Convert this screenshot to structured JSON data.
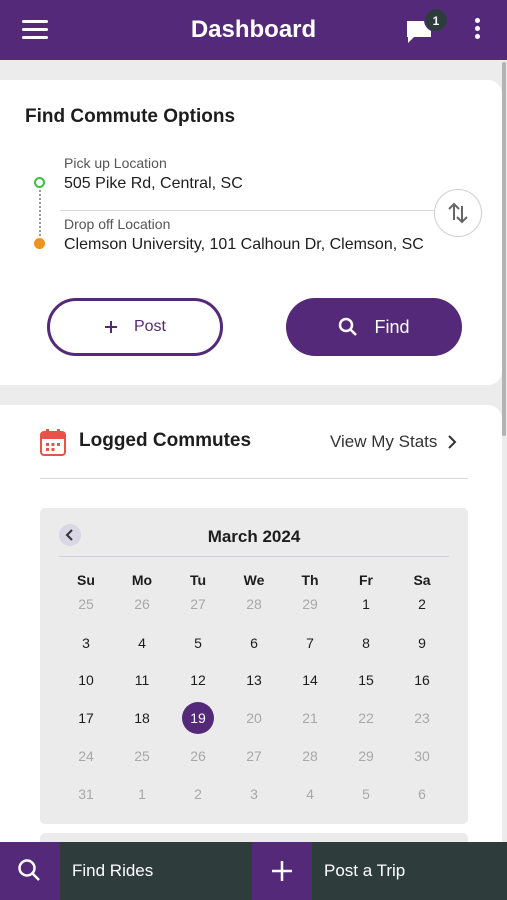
{
  "appbar": {
    "title": "Dashboard",
    "notification_count": "1",
    "accent": "#55297a"
  },
  "commute": {
    "heading": "Find Commute Options",
    "pickup_label": "Pick up Location",
    "pickup_value": "505 Pike Rd, Central, SC",
    "dropoff_label": "Drop off Location",
    "dropoff_value": "Clemson University, 101 Calhoun Dr, Clemson, SC",
    "post_label": "Post",
    "find_label": "Find"
  },
  "logged": {
    "title": "Logged Commutes",
    "stats_link": "View My Stats"
  },
  "calendar": {
    "month": "March 2024",
    "weekdays": [
      "Su",
      "Mo",
      "Tu",
      "We",
      "Th",
      "Fr",
      "Sa"
    ],
    "selected_day": "19",
    "weeks": [
      [
        {
          "d": "25",
          "m": "out"
        },
        {
          "d": "26",
          "m": "out"
        },
        {
          "d": "27",
          "m": "out"
        },
        {
          "d": "28",
          "m": "out"
        },
        {
          "d": "29",
          "m": "out"
        },
        {
          "d": "1",
          "m": "in"
        },
        {
          "d": "2",
          "m": "in"
        }
      ],
      [
        {
          "d": "3",
          "m": "in"
        },
        {
          "d": "4",
          "m": "in"
        },
        {
          "d": "5",
          "m": "in"
        },
        {
          "d": "6",
          "m": "in"
        },
        {
          "d": "7",
          "m": "in"
        },
        {
          "d": "8",
          "m": "in"
        },
        {
          "d": "9",
          "m": "in"
        }
      ],
      [
        {
          "d": "10",
          "m": "in"
        },
        {
          "d": "11",
          "m": "in"
        },
        {
          "d": "12",
          "m": "in"
        },
        {
          "d": "13",
          "m": "in"
        },
        {
          "d": "14",
          "m": "in"
        },
        {
          "d": "15",
          "m": "in"
        },
        {
          "d": "16",
          "m": "in"
        }
      ],
      [
        {
          "d": "17",
          "m": "in"
        },
        {
          "d": "18",
          "m": "in"
        },
        {
          "d": "19",
          "m": "sel"
        },
        {
          "d": "20",
          "m": "out"
        },
        {
          "d": "21",
          "m": "out"
        },
        {
          "d": "22",
          "m": "out"
        },
        {
          "d": "23",
          "m": "out"
        }
      ],
      [
        {
          "d": "24",
          "m": "out"
        },
        {
          "d": "25",
          "m": "out"
        },
        {
          "d": "26",
          "m": "out"
        },
        {
          "d": "27",
          "m": "out"
        },
        {
          "d": "28",
          "m": "out"
        },
        {
          "d": "29",
          "m": "out"
        },
        {
          "d": "30",
          "m": "out"
        }
      ],
      [
        {
          "d": "31",
          "m": "out"
        },
        {
          "d": "1",
          "m": "out"
        },
        {
          "d": "2",
          "m": "out"
        },
        {
          "d": "3",
          "m": "out"
        },
        {
          "d": "4",
          "m": "out"
        },
        {
          "d": "5",
          "m": "out"
        },
        {
          "d": "6",
          "m": "out"
        }
      ]
    ]
  },
  "bottom": {
    "find_rides": "Find Rides",
    "post_trip": "Post a Trip"
  }
}
